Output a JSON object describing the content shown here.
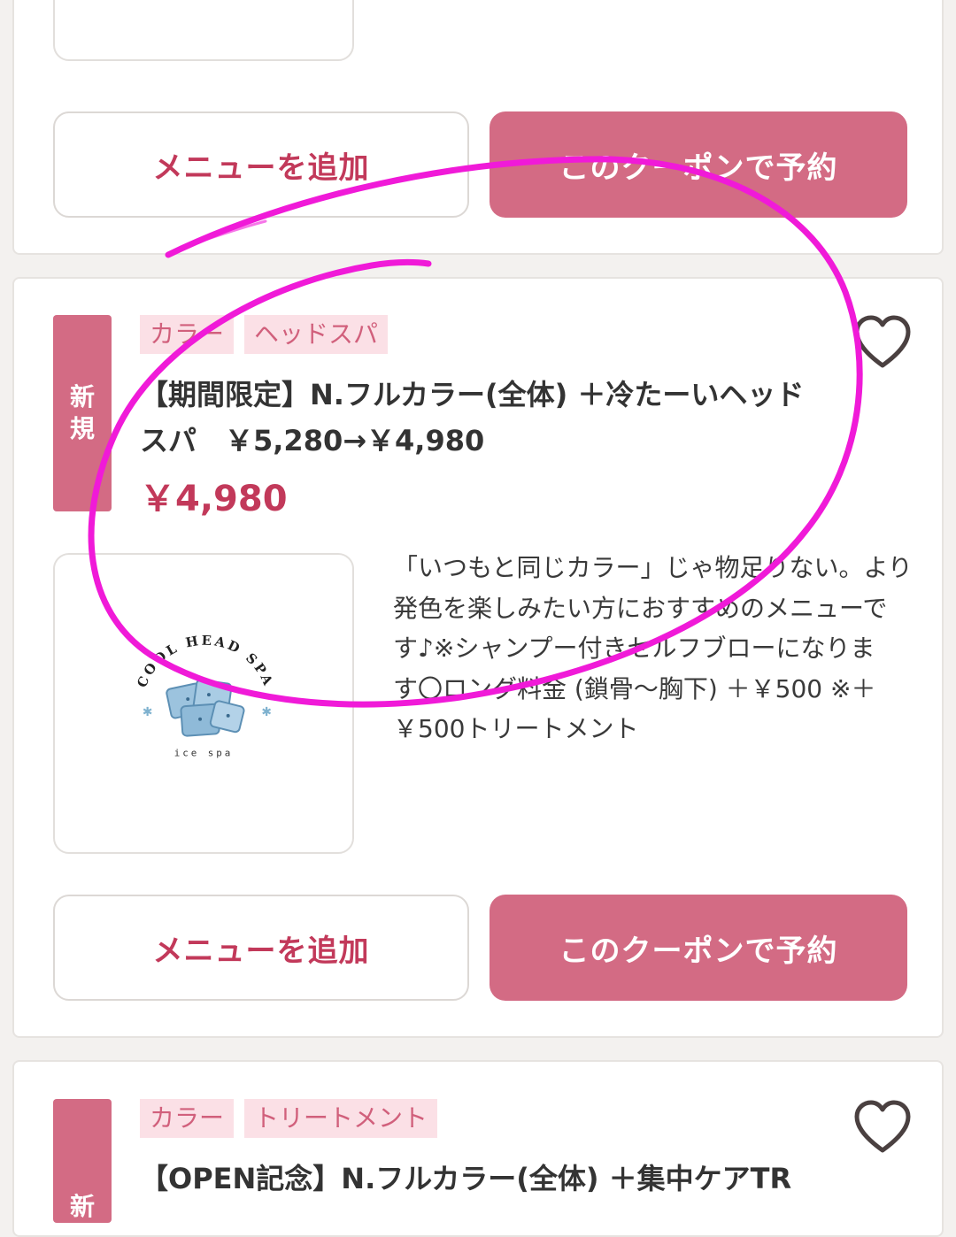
{
  "card_top": {
    "add_label": "メニューを追加",
    "book_label": "このクーポンで予約"
  },
  "card_main": {
    "new_badge": [
      "新",
      "規"
    ],
    "tags": [
      "カラー",
      "ヘッドスパ"
    ],
    "title_line1": "【期間限定】N.フルカラー(全体) ＋冷たーいヘッド",
    "title_line2": "スパ　￥5,280→￥4,980",
    "price": "￥4,980",
    "description_lines": [
      "「いつもと同じカラー」じゃ物足りない。より",
      "発色を楽しみたい方におすすめのメニューで",
      "す♪※シャンプー付きセルフブローになりま",
      "す〇ロング料金 (鎖骨〜胸下) ＋￥500 ※＋",
      "￥500トリートメント"
    ],
    "logo_text": {
      "arc": "COOL HEAD SPA",
      "sub": "ice spa"
    },
    "add_label": "メニューを追加",
    "book_label": "このクーポンで予約"
  },
  "card_bottom": {
    "new_badge": [
      "新"
    ],
    "tags": [
      "カラー",
      "トリートメント"
    ],
    "title_line1": "【OPEN記念】N.フルカラー(全体) ＋集中ケアTR"
  },
  "colors": {
    "accent": "#d36b84",
    "price_red": "#c2395a",
    "tag_bg": "#fbe0e6",
    "annotation": "#f01ad8"
  },
  "icons": {
    "favorite": "heart-icon"
  }
}
